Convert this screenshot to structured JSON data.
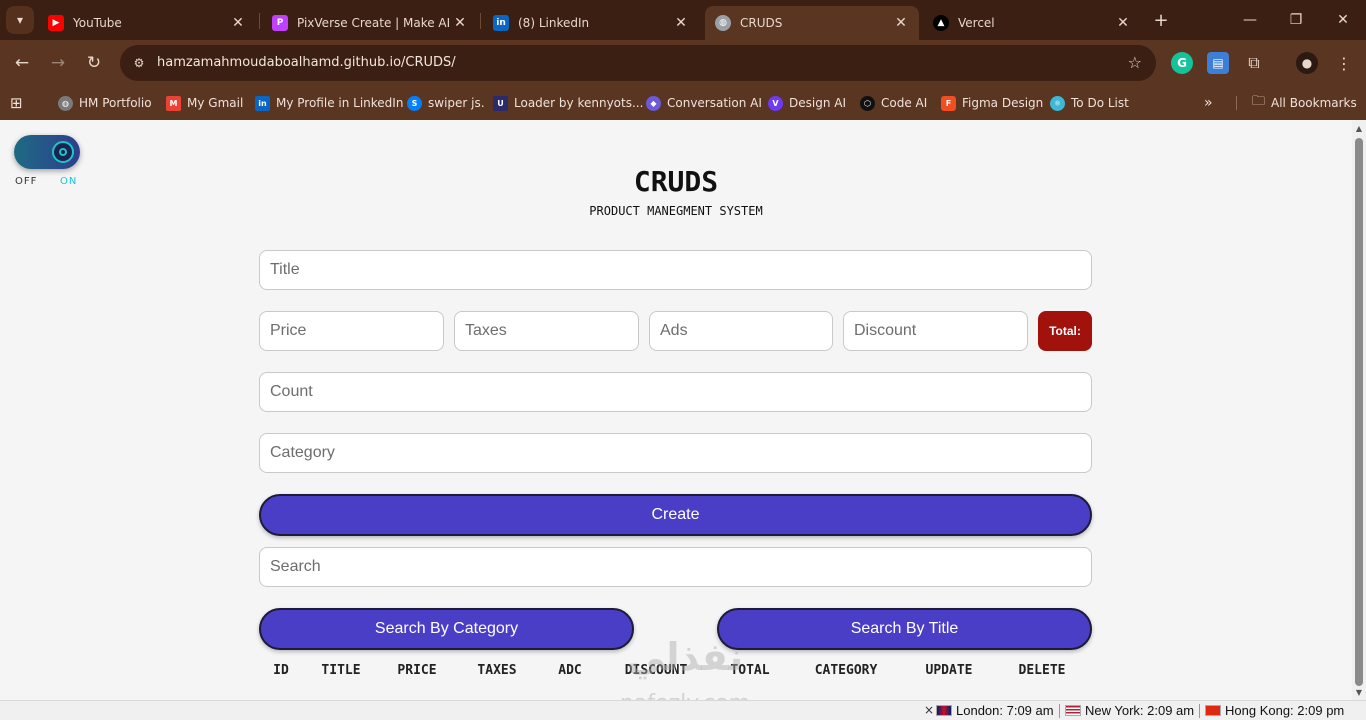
{
  "browser": {
    "tabs": [
      {
        "title": "YouTube",
        "icon": "youtube-icon",
        "color": "#ff0000"
      },
      {
        "title": "PixVerse Create | Make AI Vid",
        "icon": "pixverse-icon",
        "color": "#c040ff"
      },
      {
        "title": "(8) LinkedIn",
        "icon": "linkedin-icon",
        "color": "#0a66c2"
      },
      {
        "title": "CRUDS",
        "icon": "globe-icon",
        "color": "#9aa0a6"
      },
      {
        "title": "Vercel",
        "icon": "vercel-icon",
        "color": "#000000"
      }
    ],
    "active_tab": 3,
    "url": "hamzamahmoudaboalhamd.github.io/CRUDS/",
    "bookmarks": [
      {
        "label": "HM Portfolio",
        "icon": "globe-icon",
        "color": "#7a7a7a"
      },
      {
        "label": "My Gmail",
        "icon": "gmail-icon",
        "color": "#ea4335"
      },
      {
        "label": "My Profile in LinkedIn",
        "icon": "linkedin-icon",
        "color": "#0a66c2"
      },
      {
        "label": "swiper js.",
        "icon": "swiper-icon",
        "color": "#0080ff"
      },
      {
        "label": "Loader by kennyots...",
        "icon": "uiverse-icon",
        "color": "#2b2b6b"
      },
      {
        "label": "Conversation AI",
        "icon": "conversation-ai-icon",
        "color": "#6b5bd6"
      },
      {
        "label": "Design AI",
        "icon": "design-ai-icon",
        "color": "#6d3bf5"
      },
      {
        "label": "Code AI",
        "icon": "code-ai-icon",
        "color": "#111111"
      },
      {
        "label": "Figma Design",
        "icon": "figma-icon",
        "color": "#f24e1e"
      },
      {
        "label": "To Do List",
        "icon": "react-icon",
        "color": "#3fb7d6"
      }
    ],
    "all_bookmarks": "All Bookmarks"
  },
  "toggle": {
    "off_label": "OFF",
    "on_label": "ON",
    "state": "on"
  },
  "app": {
    "title": "CRUDS",
    "subtitle": "PRODUCT MANEGMENT SYSTEM"
  },
  "form": {
    "title_placeholder": "Title",
    "price_placeholder": "Price",
    "taxes_placeholder": "Taxes",
    "ads_placeholder": "Ads",
    "discount_placeholder": "Discount",
    "total_label": "Total:",
    "count_placeholder": "Count",
    "category_placeholder": "Category",
    "create_label": "Create",
    "search_placeholder": "Search",
    "search_category_label": "Search By Category",
    "search_title_label": "Search By Title"
  },
  "table": {
    "headers": [
      "ID",
      "TITLE",
      "PRICE",
      "TAXES",
      "ADC",
      "DISCOUNT",
      "TOTAL",
      "CATEGORY",
      "UPDATE",
      "DELETE"
    ]
  },
  "watermark": {
    "arabic": "نفذلي",
    "latin": "nafezly.com"
  },
  "status": {
    "clocks": [
      {
        "label": "London: 7:09 am"
      },
      {
        "label": "New York: 2:09 am"
      },
      {
        "label": "Hong Kong: 2:09 pm"
      }
    ]
  },
  "colors": {
    "accent": "#4a3ec6",
    "total_bg": "#a0120b",
    "toggle_on": "#14c8e0",
    "chrome_dark": "#3b1f12",
    "chrome": "#5a3522"
  }
}
